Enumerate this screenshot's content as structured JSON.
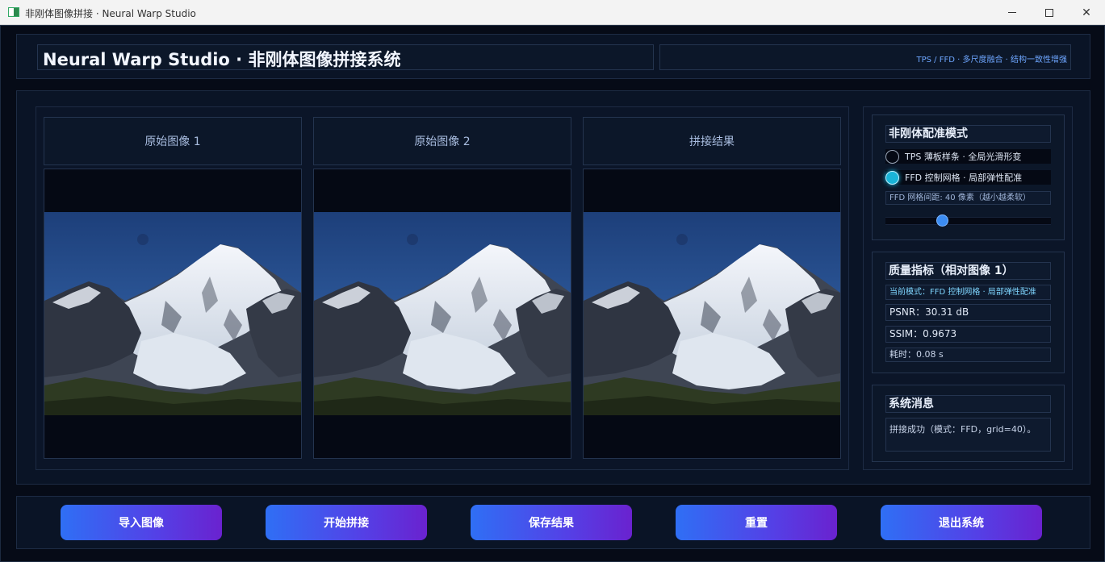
{
  "window": {
    "title": "非刚体图像拼接 · Neural Warp Studio",
    "minimize_icon": "minimize-icon",
    "maximize_icon": "maximize-icon",
    "close_icon": "close-icon"
  },
  "header": {
    "title": "Neural Warp Studio · 非刚体图像拼接系统",
    "subtitle": "TPS / FFD · 多尺度融合 · 结构一致性增强"
  },
  "panels": [
    {
      "label": "原始图像 1"
    },
    {
      "label": "原始图像 2"
    },
    {
      "label": "拼接结果"
    }
  ],
  "mode_card": {
    "title": "非刚体配准模式",
    "options": [
      {
        "label": "TPS 薄板样条 · 全局光滑形变",
        "selected": false
      },
      {
        "label": "FFD 控制网格 · 局部弹性配准",
        "selected": true
      }
    ],
    "grid_label": "FFD 网格间距: 40 像素（越小越柔软）",
    "slider_fraction": 0.33
  },
  "quality_card": {
    "title": "质量指标（相对图像 1）",
    "mode": "当前模式：FFD 控制网格 · 局部弹性配准",
    "psnr": "PSNR：30.31 dB",
    "ssim": "SSIM：0.9673",
    "time": "耗时：0.08 s"
  },
  "message_card": {
    "title": "系统消息",
    "text": "拼接成功（模式：FFD，grid=40）。"
  },
  "toolbar": {
    "import_label": "导入图像",
    "start_label": "开始拼接",
    "save_label": "保存结果",
    "reset_label": "重置",
    "exit_label": "退出系统"
  },
  "colors": {
    "accent": "#3c8cf2",
    "radio_on": "#19b4d8",
    "button_start": "#2f6ff5",
    "button_end": "#6a22cf"
  }
}
